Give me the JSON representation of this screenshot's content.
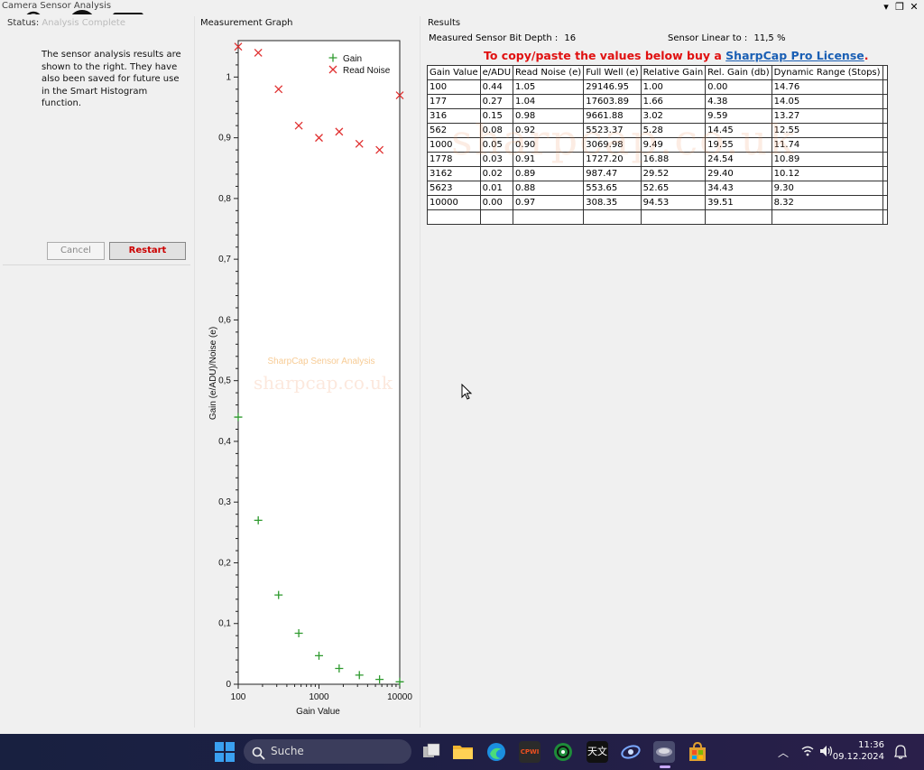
{
  "window": {
    "title": "Camera Sensor Analysis"
  },
  "left": {
    "status_label": "Status:",
    "status_value": "Analysis Complete",
    "info": "The sensor analysis results are shown to the right. They have also been saved for future use in the Smart Histogram function.",
    "cancel_label": "Cancel",
    "restart_label": "Restart"
  },
  "graph": {
    "panel_title": "Measurement Graph",
    "watermark_title": "SharpCap Sensor Analysis",
    "watermark_url": "sharpcap.co.uk"
  },
  "chart_data": {
    "type": "scatter",
    "xlabel": "Gain Value",
    "ylabel": "Gain (e/ADU)/Noise (e)",
    "xscale": "log",
    "xlim": [
      100,
      10000
    ],
    "ylim": [
      0,
      1.06
    ],
    "x_ticks": [
      "100",
      "1000",
      "10000"
    ],
    "y_ticks": [
      "0",
      "0,1",
      "0,2",
      "0,3",
      "0,4",
      "0,5",
      "0,6",
      "0,7",
      "0,8",
      "0,9",
      "1"
    ],
    "legend_position": "top-right",
    "series": [
      {
        "name": "Gain",
        "color": "#2e9a2e",
        "marker": "plus",
        "x": [
          100,
          177,
          316,
          562,
          1000,
          1778,
          3162,
          5623,
          10000
        ],
        "y": [
          0.44,
          0.27,
          0.147,
          0.084,
          0.047,
          0.026,
          0.015,
          0.008,
          0.004
        ]
      },
      {
        "name": "Read Noise",
        "color": "#e03030",
        "marker": "cross",
        "x": [
          100,
          177,
          316,
          562,
          1000,
          1778,
          3162,
          5623,
          10000
        ],
        "y": [
          1.05,
          1.04,
          0.98,
          0.92,
          0.9,
          0.91,
          0.89,
          0.88,
          0.97
        ]
      }
    ]
  },
  "results": {
    "panel_title": "Results",
    "bit_depth_label": "Measured Sensor Bit Depth :",
    "bit_depth_value": "16",
    "linear_label": "Sensor Linear to :",
    "linear_value": "11,5 %",
    "promo_text": "To copy/paste the values below buy a ",
    "promo_link": "SharpCap Pro License",
    "promo_end": ".",
    "watermark": "sharpcap.co.uk",
    "columns": [
      "Gain Value",
      "e/ADU",
      "Read Noise (e)",
      "Full Well (e)",
      "Relative Gain",
      "Rel. Gain (db)",
      "Dynamic Range (Stops)",
      ""
    ],
    "rows": [
      [
        "100",
        "0.44",
        "1.05",
        "29146.95",
        "1.00",
        "0.00",
        "14.76",
        ""
      ],
      [
        "177",
        "0.27",
        "1.04",
        "17603.89",
        "1.66",
        "4.38",
        "14.05",
        ""
      ],
      [
        "316",
        "0.15",
        "0.98",
        "9661.88",
        "3.02",
        "9.59",
        "13.27",
        ""
      ],
      [
        "562",
        "0.08",
        "0.92",
        "5523.37",
        "5.28",
        "14.45",
        "12.55",
        ""
      ],
      [
        "1000",
        "0.05",
        "0.90",
        "3069.98",
        "9.49",
        "19.55",
        "11.74",
        ""
      ],
      [
        "1778",
        "0.03",
        "0.91",
        "1727.20",
        "16.88",
        "24.54",
        "10.89",
        ""
      ],
      [
        "3162",
        "0.02",
        "0.89",
        "987.47",
        "29.52",
        "29.40",
        "10.12",
        ""
      ],
      [
        "5623",
        "0.01",
        "0.88",
        "553.65",
        "52.65",
        "34.43",
        "9.30",
        ""
      ],
      [
        "10000",
        "0.00",
        "0.97",
        "308.35",
        "94.53",
        "39.51",
        "8.32",
        ""
      ],
      [
        "",
        "",
        "",
        "",
        "",
        "",
        "",
        ""
      ]
    ]
  },
  "taskbar": {
    "search_placeholder": "Suche",
    "time": "11:36",
    "date": "09.12.2024",
    "cpwi_label": "CPWI",
    "tianwen_label": "天文"
  }
}
